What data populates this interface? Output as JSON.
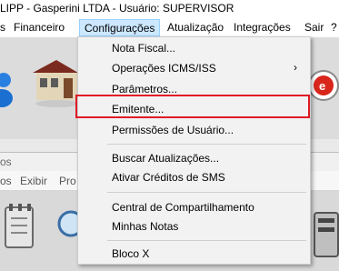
{
  "titlebar": {
    "title": "LIPP - Gasperini LTDA - Usuário: SUPERVISOR"
  },
  "menubar": {
    "items": [
      "s",
      "Financeiro",
      "Configurações",
      "Atualização",
      "Integrações",
      "Sair",
      "?"
    ]
  },
  "subwindow": {
    "title_fragment": "os",
    "menu": [
      "os",
      "Exibir",
      "Pro"
    ]
  },
  "dropdown": {
    "items": [
      "Nota Fiscal...",
      "Operações ICMS/ISS",
      "Parâmetros...",
      "Emitente...",
      "Permissões de Usuário...",
      "Buscar Atualizações...",
      "Ativar Créditos de SMS",
      "Central de Compartilhamento",
      "Minhas Notas",
      "Bloco X"
    ],
    "submenu_arrow": "›",
    "highlighted_item": "Emitente..."
  },
  "colors": {
    "menu_active_bg": "#cce8ff",
    "menu_active_border": "#99d1ff",
    "highlight_border": "#e01b24",
    "dropdown_bg": "#f2f2f2"
  }
}
